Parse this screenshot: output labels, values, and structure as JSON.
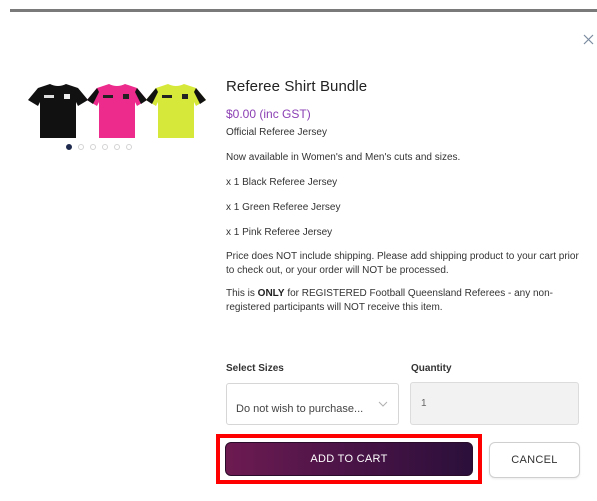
{
  "product": {
    "title": "Referee Shirt Bundle",
    "price": "$0.00 (inc GST)",
    "description": {
      "subtitle": "Official Referee Jersey",
      "cuts": "Now available in Women's and Men's cuts and sizes.",
      "items": [
        "x 1 Black Referee Jersey",
        "x 1 Green Referee Jersey",
        "x 1 Pink Referee Jersey"
      ],
      "shipping_note": "Price does NOT include shipping. Please add shipping product to your cart prior to check out, or your order will NOT be processed.",
      "eligibility_pre": "This is ",
      "eligibility_bold": "ONLY",
      "eligibility_post": " for REGISTERED Football Queensland Referees - any non-registered participants will NOT receive this item."
    },
    "image": {
      "shirts": [
        "black-shirt",
        "pink-shirt",
        "lime-shirt"
      ],
      "shirt_colors": [
        "#111111",
        "#ec2b8c",
        "#d6e83a"
      ],
      "gallery_dots": 6,
      "active_dot": 0
    }
  },
  "form": {
    "size_label": "Select Sizes",
    "size_value": "Do not wish to purchase...",
    "quantity_label": "Quantity",
    "quantity_placeholder": "1"
  },
  "actions": {
    "add_to_cart": "ADD TO CART",
    "cancel": "CANCEL"
  },
  "colors": {
    "price": "#8b3fb3",
    "button_gradient_start": "#6d1b51",
    "button_gradient_end": "#2b0f3a",
    "highlight": "#ff0000"
  },
  "icons": {
    "close": "close-icon",
    "dropdown": "chevron-down-icon"
  }
}
